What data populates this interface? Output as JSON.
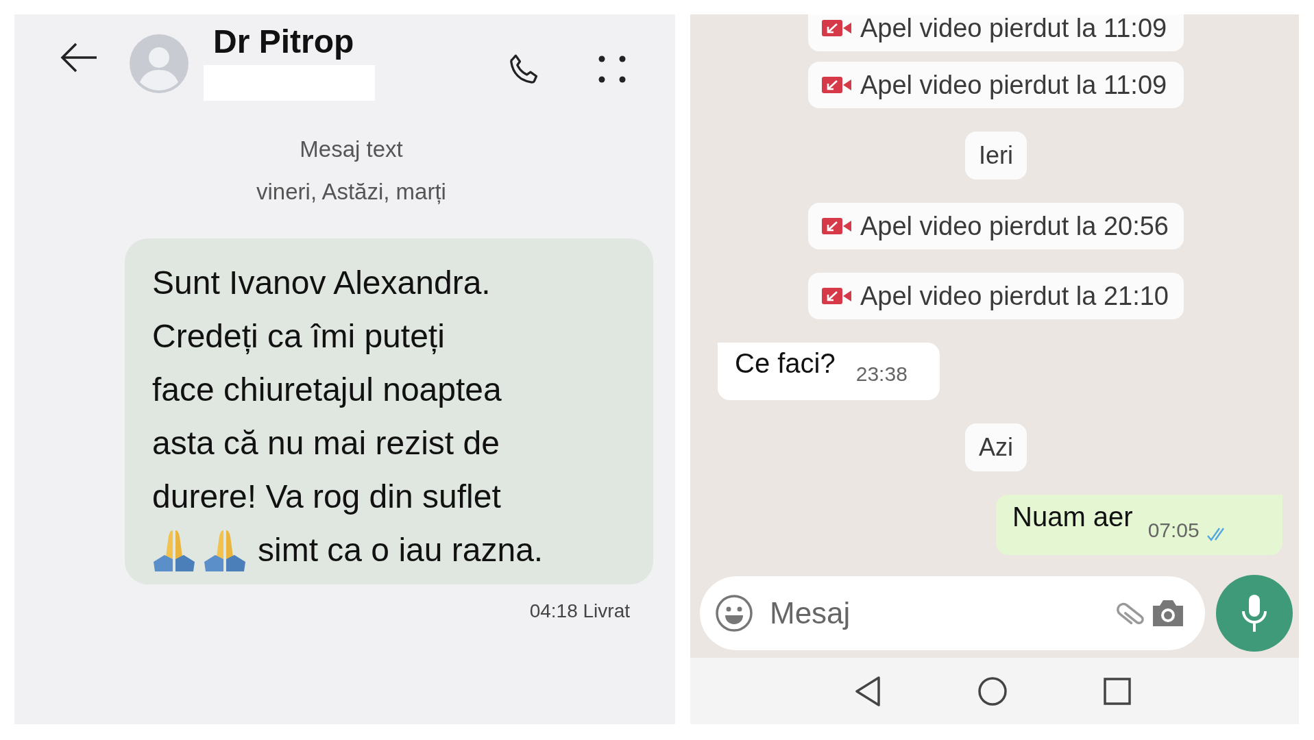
{
  "sms": {
    "contact_name": "Dr Pitrop",
    "thread_label": "Mesaj text",
    "thread_dates": "vineri, Astăzi, marți",
    "message": {
      "text": "Sunt Ivanov Alexandra.\nCredeți ca îmi puteți\nface chiuretajul noaptea\nasta că nu mai rezist de\ndurere! Va rog din suflet",
      "after_icons": "simt ca o iau razna.",
      "status": "04:18 Livrat"
    }
  },
  "chat": {
    "items": [
      {
        "kind": "call",
        "text": "Apel video pierdut la 11:09"
      },
      {
        "kind": "call",
        "text": "Apel video pierdut la 11:09"
      },
      {
        "kind": "date",
        "text": "Ieri"
      },
      {
        "kind": "call",
        "text": "Apel video pierdut la 20:56"
      },
      {
        "kind": "call",
        "text": "Apel video pierdut la 21:10"
      },
      {
        "kind": "incoming",
        "text": "Ce faci?",
        "time": "23:38"
      },
      {
        "kind": "date",
        "text": "Azi"
      },
      {
        "kind": "outgoing",
        "text": "Nuam aer",
        "time": "07:05",
        "read": true
      }
    ],
    "composer": {
      "placeholder": "Mesaj"
    }
  }
}
